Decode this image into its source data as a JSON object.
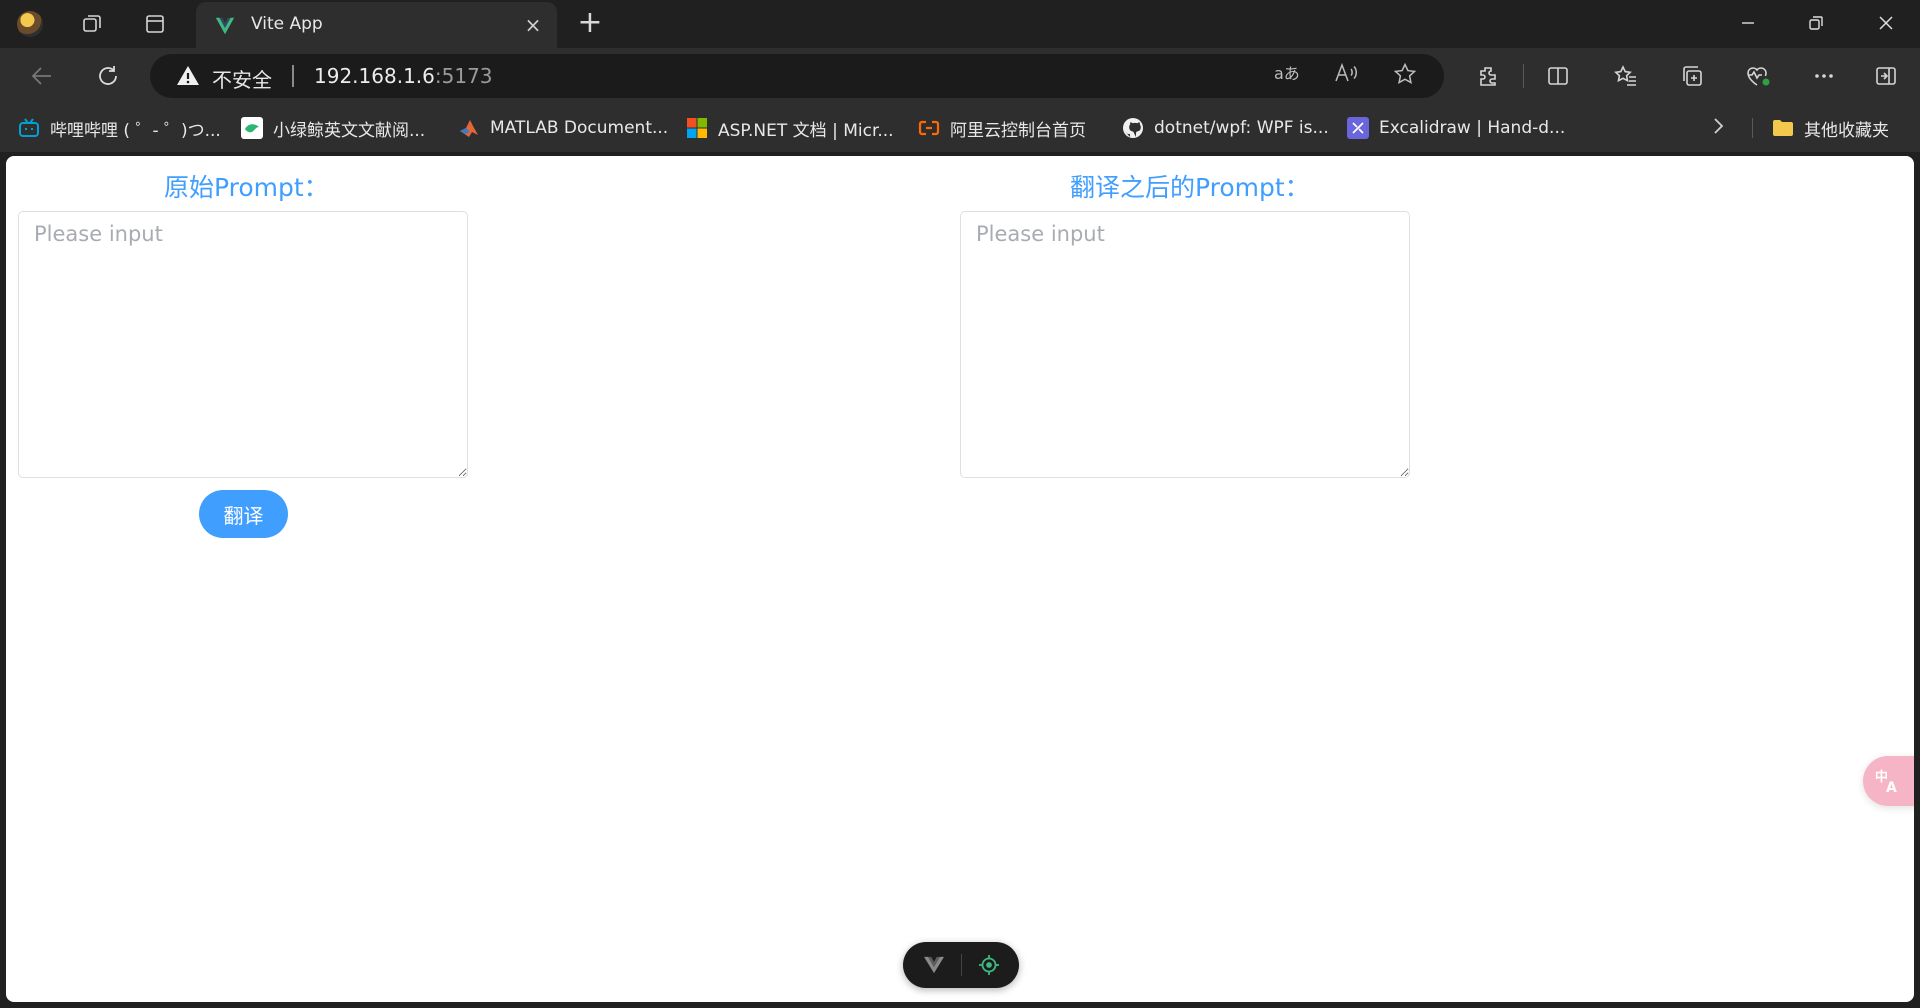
{
  "window": {
    "tab_title": "Vite App",
    "new_tab_symbol": "+",
    "close_tab_symbol": "×"
  },
  "address_bar": {
    "security_label": "不安全",
    "host": "192.168.1.6",
    "port": ":5173"
  },
  "bookmarks": {
    "items": [
      {
        "label": "哔哩哔哩 ( ゜- ゜)つ...",
        "icon": "bilibili-icon",
        "color": "#00a1d6"
      },
      {
        "label": "小绿鲸英文文献阅...",
        "icon": "green-whale-icon",
        "color": "#2bb673"
      },
      {
        "label": "MATLAB Document...",
        "icon": "matlab-icon",
        "color": "#e16737"
      },
      {
        "label": "ASP.NET 文档 | Micr...",
        "icon": "microsoft-icon",
        "color": "#f25022"
      },
      {
        "label": "阿里云控制台首页",
        "icon": "aliyun-icon",
        "color": "#ff6a00"
      },
      {
        "label": "dotnet/wpf: WPF is...",
        "icon": "github-icon",
        "color": "#ffffff"
      },
      {
        "label": "Excalidraw | Hand-d...",
        "icon": "excalidraw-icon",
        "color": "#6965db"
      }
    ],
    "other_folder": "其他收藏夹"
  },
  "page": {
    "original_title": "原始Prompt：",
    "translated_title": "翻译之后的Prompt：",
    "original_placeholder": "Please input",
    "translated_placeholder": "Please input",
    "original_value": "",
    "translated_value": "",
    "translate_button": "翻译",
    "accent_color": "#409eff"
  }
}
